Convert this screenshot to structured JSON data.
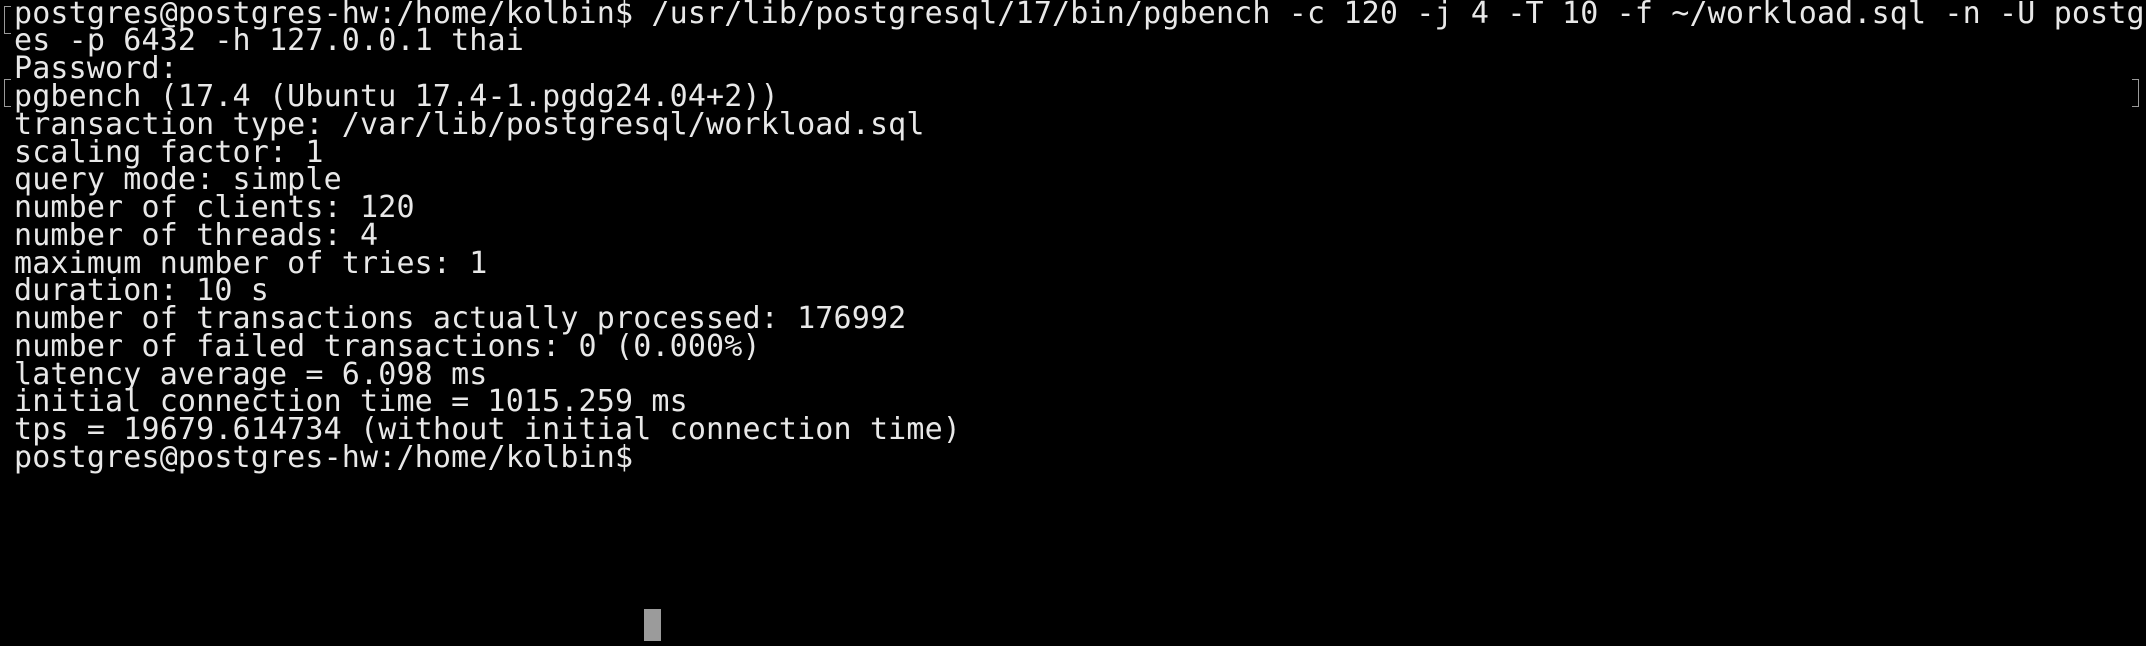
{
  "terminal": {
    "colors": {
      "background": "#000000",
      "foreground": "#e8e8e8",
      "cursor": "#9b9b9b"
    },
    "lines": [
      "postgres@postgres-hw:/home/kolbin$ /usr/lib/postgresql/17/bin/pgbench -c 120 -j 4 -T 10 -f ~/workload.sql -n -U postgr",
      "es -p 6432 -h 127.0.0.1 thai",
      "Password:",
      "pgbench (17.4 (Ubuntu 17.4-1.pgdg24.04+2))",
      "transaction type: /var/lib/postgresql/workload.sql",
      "scaling factor: 1",
      "query mode: simple",
      "number of clients: 120",
      "number of threads: 4",
      "maximum number of tries: 1",
      "duration: 10 s",
      "number of transactions actually processed: 176992",
      "number of failed transactions: 0 (0.000%)",
      "latency average = 6.098 ms",
      "initial connection time = 1015.259 ms",
      "tps = 19679.614734 (without initial connection time)",
      "postgres@postgres-hw:/home/kolbin$ "
    ]
  }
}
